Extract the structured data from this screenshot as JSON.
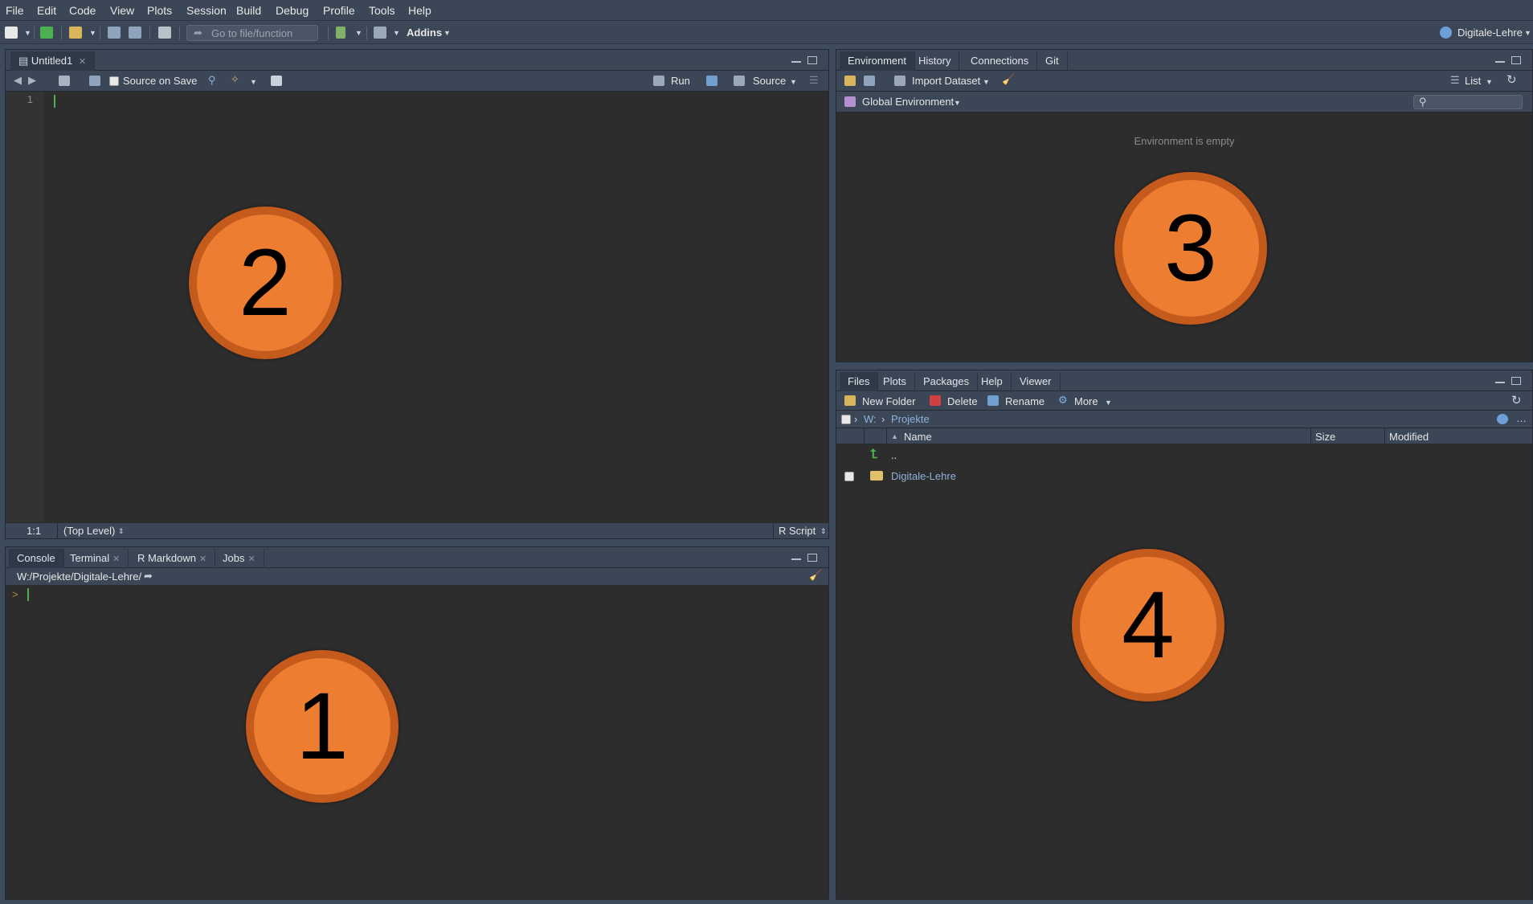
{
  "menu": [
    "File",
    "Edit",
    "Code",
    "View",
    "Plots",
    "Session",
    "Build",
    "Debug",
    "Profile",
    "Tools",
    "Help"
  ],
  "toolbar": {
    "goto_placeholder": "Go to file/function",
    "addins": "Addins",
    "project": "Digitale-Lehre"
  },
  "source": {
    "tab": "Untitled1",
    "source_on_save": "Source on Save",
    "run": "Run",
    "source": "Source",
    "line_number": "1",
    "status_pos": "1:1",
    "status_scope": "(Top Level)",
    "status_type": "R Script"
  },
  "console": {
    "tabs": [
      "Console",
      "Terminal",
      "R Markdown",
      "Jobs"
    ],
    "path": "W:/Projekte/Digitale-Lehre/",
    "prompt": ">"
  },
  "env": {
    "tabs": [
      "Environment",
      "History",
      "Connections",
      "Git"
    ],
    "import_dataset": "Import Dataset",
    "list": "List",
    "global_env": "Global Environment",
    "empty_msg": "Environment is empty"
  },
  "files": {
    "tabs": [
      "Files",
      "Plots",
      "Packages",
      "Help",
      "Viewer"
    ],
    "new_folder": "New Folder",
    "delete": "Delete",
    "rename": "Rename",
    "more": "More",
    "breadcrumb_root": "W:",
    "breadcrumb_dir": "Projekte",
    "col_name": "Name",
    "col_size": "Size",
    "col_modified": "Modified",
    "rows": [
      "..",
      "Digitale-Lehre"
    ]
  },
  "markers": [
    "1",
    "2",
    "3",
    "4"
  ],
  "colors": {
    "marker_fill": "#ed7d31",
    "marker_ring": "#c55a1d",
    "pane_bg": "#2d2d2d",
    "chrome": "#3b4656"
  }
}
